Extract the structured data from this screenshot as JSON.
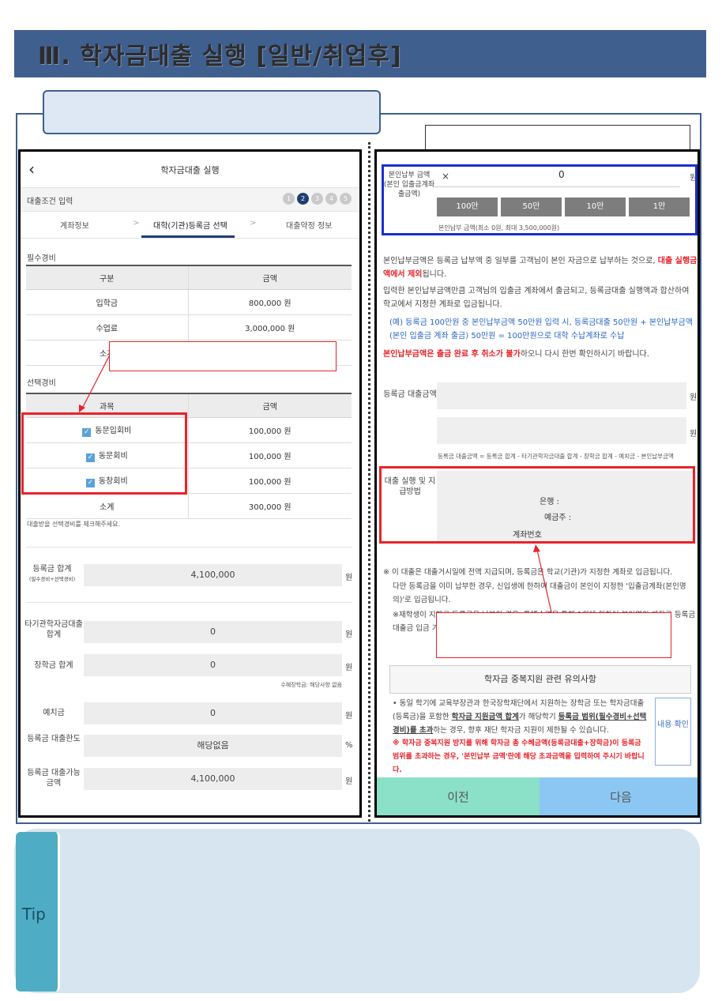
{
  "page": {
    "title": "Ⅲ. 학자금대출 실행 [일반/취업후]",
    "subtitle": "",
    "right_caption": "",
    "left_callout": "",
    "right_callout": "",
    "tip_label": "Tip",
    "tip_text": ""
  },
  "left_screen": {
    "header_title": "학자금대출 실행",
    "condition_label": "대출조건 입력",
    "steps": [
      "1",
      "2",
      "3",
      "4",
      "5"
    ],
    "tabs": [
      "계좌정보",
      "대학(기관)등록금 선택",
      "대출약정 정보"
    ],
    "required_title": "필수경비",
    "required_headers": [
      "구분",
      "금액"
    ],
    "required_rows": [
      {
        "label": "입학금",
        "amount": "800,000 원"
      },
      {
        "label": "수업료",
        "amount": "3,000,000 원"
      },
      {
        "label": "소계",
        "amount": ""
      }
    ],
    "optional_title": "선택경비",
    "optional_headers": [
      "과목",
      "금액"
    ],
    "optional_rows": [
      {
        "label": "동문입회비",
        "amount": "100,000 원"
      },
      {
        "label": "동문회비",
        "amount": "100,000 원"
      },
      {
        "label": "동창회비",
        "amount": "100,000 원"
      }
    ],
    "optional_subtotal": {
      "label": "소계",
      "amount": "300,000 원"
    },
    "optional_hint": "대출받을 선택경비를 체크해주세요.",
    "tuition_total": {
      "label": "등록금 합계",
      "sublabel": "(필수경비+선택경비)",
      "value": "4,100,000",
      "unit": "원"
    },
    "other_loan": {
      "label": "타기관학자금대출 합계",
      "value": "0",
      "unit": "원"
    },
    "scholarship": {
      "label": "장학금 합계",
      "value": "0",
      "unit": "원",
      "note": "수혜장학금: 해당사항 없음"
    },
    "deposit": {
      "label": "예치금",
      "value": "0",
      "unit": "원"
    },
    "loan_limit": {
      "label": "등록금 대출한도",
      "value": "해당없음",
      "unit": "%"
    },
    "loan_available": {
      "label": "등록금 대출가능 금액",
      "value": "4,100,000",
      "unit": "원"
    }
  },
  "right_screen": {
    "self_pay_label": "본인납부 금액 (본인 입출금계좌 출금액)",
    "clear_icon": "×",
    "self_pay_value": "0",
    "unit": "원",
    "quick_buttons": [
      "100만",
      "50만",
      "10만",
      "1만"
    ],
    "range_note": "본인납부 금액(최소 0원, 최대 3,500,000원)",
    "para1_pre": "본인납부금액은 등록금 납부액 중 일부를 고객님이 본인 자금으로 납부하는 것으로,",
    "para1_red": "대출 실행금액에서 제외",
    "para1_post": "됩니다.",
    "para2": "입력한 본인납부금액만큼 고객님의 입출금 계좌에서 출금되고, 등록금대출 실행액과 합산하여 학교에서 지정한 계좌로 입금됩니다.",
    "para3": "(예) 등록금 100만원 중 본인납부금액 50만원 입력 시, 등록금대출 50만원 + 본인납부금액(본인 입출금 계좌 출금) 50만원 = 100만원으로 대학 수납계좌로 수납",
    "para4_red": "본인납부금액은 출금 완료 후 취소가 불가",
    "para4_post": "하오니 다시 한번 확인하시기 바랍니다.",
    "loan_amount_label": "등록금 대출금액",
    "formula": "등록금 대출금액 = 등록금 합계 - 타기관학자금대출 합계 - 장학금 합계 - 예치금 - 본인납부금액",
    "pay_method_label": "대출 실행 및 지급방법",
    "bank_label": "은행 :",
    "holder_label": "예금주 :",
    "account_label": "계좌번호",
    "notice1": "※ 이 대출은 대출거시일에 전액 지급되며, 등록금은 학교(기관)가 지정한 계좌로 입금됩니다.",
    "notice2": "다만 등록금을 이미 납부한 경우, 신입생에 한하여 대출금이 본인이 지정한 '입출금계좌(본인명의)'로 입금됩니다.",
    "notice3": "※재학생이 지해로 등록금을 납부한 경우, 통帳수엽을 통해 1회에 한하여 본인명의 계좌로 등록금 대출금 입금 가능",
    "notice_header": "학자금 중복지원 관련 유의사항",
    "notice_body_1": "• 동일 학기에 교육부장관과 한국장학재단에서 지원하는 장학금 또는 학자금대출(등록금)을 포함한 ",
    "notice_body_u1": "학자금 지원금액 합계",
    "notice_body_2": "가 해당학기 ",
    "notice_body_u2": "등록금 범위(필수경비+선택경비)를 초과",
    "notice_body_3": "하는 경우, 향후 재단 학자금 지원이 제한될 수 있습니다.",
    "notice_red": "※ 학자금 중복지원 방지를 위해 학자금 총 수혜금액(등록금대출+장학금)이 등록금 범위를 초과하는 경우, '본인납부 금액'란에 해당 초과금액을 입력하여 주시기 바랍니다.",
    "confirm_button": "내용 확인",
    "prev_button": "이전",
    "next_button": "다음"
  },
  "colors": {
    "title_bar": "#3f5f8e",
    "highlight_red": "#e8232a",
    "highlight_blue": "#1b2ed1",
    "step_active": "#1f3e73",
    "tip_bg": "#d6e5ef",
    "tip_strip": "#4eadc4"
  }
}
